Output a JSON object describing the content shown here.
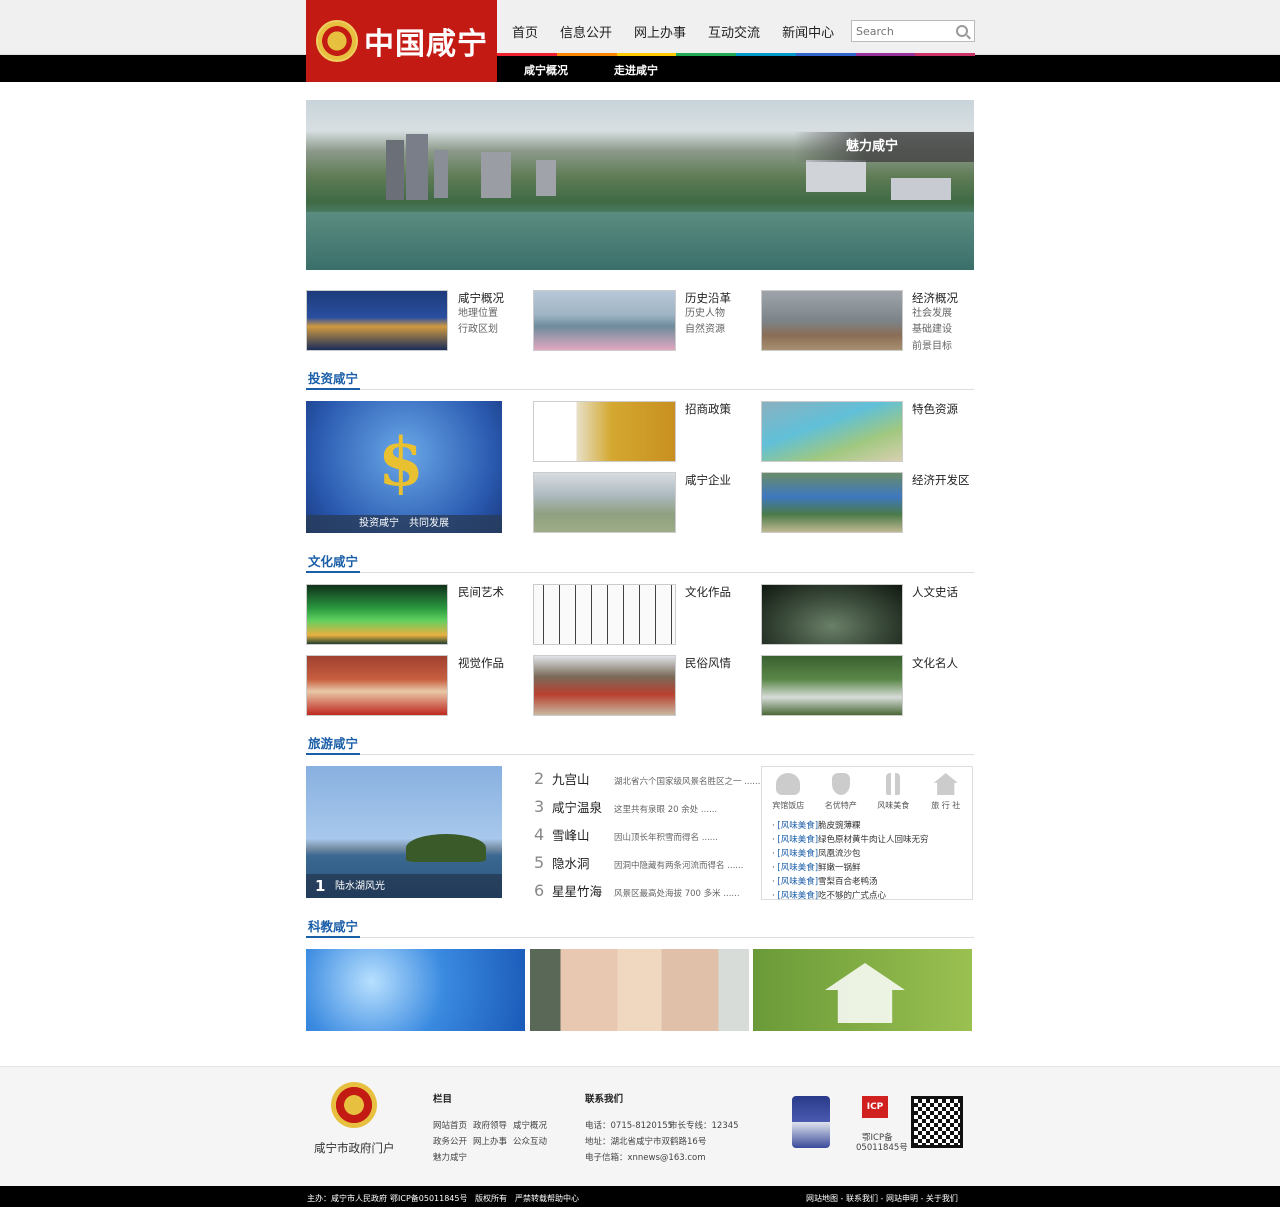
{
  "header": {
    "logo_text": "中国咸宁",
    "nav": [
      "首页",
      "信息公开",
      "网上办事",
      "互动交流",
      "新闻中心"
    ],
    "search_placeholder": "Search",
    "sub_nav": [
      "咸宁概况",
      "走进咸宁"
    ],
    "strip_colors": [
      "#e23",
      "#f80",
      "#fc0",
      "#2a5",
      "#09c",
      "#36c",
      "#939",
      "#c36"
    ]
  },
  "banner": {
    "caption": "魅力咸宁"
  },
  "overview": [
    {
      "title": "咸宁概况",
      "subs": [
        "地理位置",
        "行政区划"
      ]
    },
    {
      "title": "历史沿革",
      "subs": [
        "历史人物",
        "自然资源"
      ]
    },
    {
      "title": "经济概况",
      "subs": [
        "社会发展",
        "基础建设",
        "前景目标"
      ]
    }
  ],
  "invest": {
    "section": "投资咸宁",
    "big_caption": "投资咸宁　共同发展",
    "items": [
      "招商政策",
      "特色资源",
      "咸宁企业",
      "经济开发区"
    ]
  },
  "culture": {
    "section": "文化咸宁",
    "items": [
      "民间艺术",
      "文化作品",
      "人文史话",
      "视觉作品",
      "民俗风情",
      "文化名人"
    ]
  },
  "travel": {
    "section": "旅游咸宁",
    "big_num": "1",
    "big_caption": "陆水湖风光",
    "list": [
      {
        "num": "2",
        "name": "九宫山",
        "desc": "湖北省六个国家级风景名胜区之一 ......"
      },
      {
        "num": "3",
        "name": "咸宁温泉",
        "desc": "这里共有泉眼 20 余处 ......"
      },
      {
        "num": "4",
        "name": "雪峰山",
        "desc": "因山顶长年积雪而得名 ......"
      },
      {
        "num": "5",
        "name": "隐水洞",
        "desc": "因洞中隐藏有两条河流而得名 ......"
      },
      {
        "num": "6",
        "name": "星星竹海",
        "desc": "风景区最高处海拔 700 多米 ......"
      }
    ],
    "food_tabs": [
      "宾馆饭店",
      "名优特产",
      "风味美食",
      "旅 行 社"
    ],
    "food_list": [
      {
        "tag": "[风味美食]",
        "text": "脆皮豌薄粿"
      },
      {
        "tag": "[风味美食]",
        "text": "绿色原材黄牛肉让人回味无穷"
      },
      {
        "tag": "[风味美食]",
        "text": "凤凰流沙包"
      },
      {
        "tag": "[风味美食]",
        "text": "鲜嫩一锅鲜"
      },
      {
        "tag": "[风味美食]",
        "text": "雪梨百合老鸭汤"
      },
      {
        "tag": "[风味美食]",
        "text": "吃不够的广式点心"
      }
    ]
  },
  "science": {
    "section": "科教咸宁"
  },
  "footer": {
    "portal_name": "咸宁市政府门户",
    "col_title": "栏目",
    "col_links": [
      "网站首页",
      "政府领导",
      "咸宁概况",
      "政务公开",
      "网上办事",
      "公众互动",
      "魅力咸宁"
    ],
    "contact_title": "联系我们",
    "phone": "电话：0715-8120155",
    "hotline": "市长专线：12345",
    "address": "地址：湖北省咸宁市双鹤路16号",
    "email": "电子信箱：xnnews@163.com",
    "icp_badge": "鄂ICP备",
    "icp_no": "05011845号",
    "bottom_left": [
      "主办：咸宁市人民政府",
      "鄂ICP备05011845号",
      "版权所有",
      "严禁转载帮助中心"
    ],
    "bottom_right": "网站地图 - 联系我们 - 网站申明 - 关于我们"
  }
}
